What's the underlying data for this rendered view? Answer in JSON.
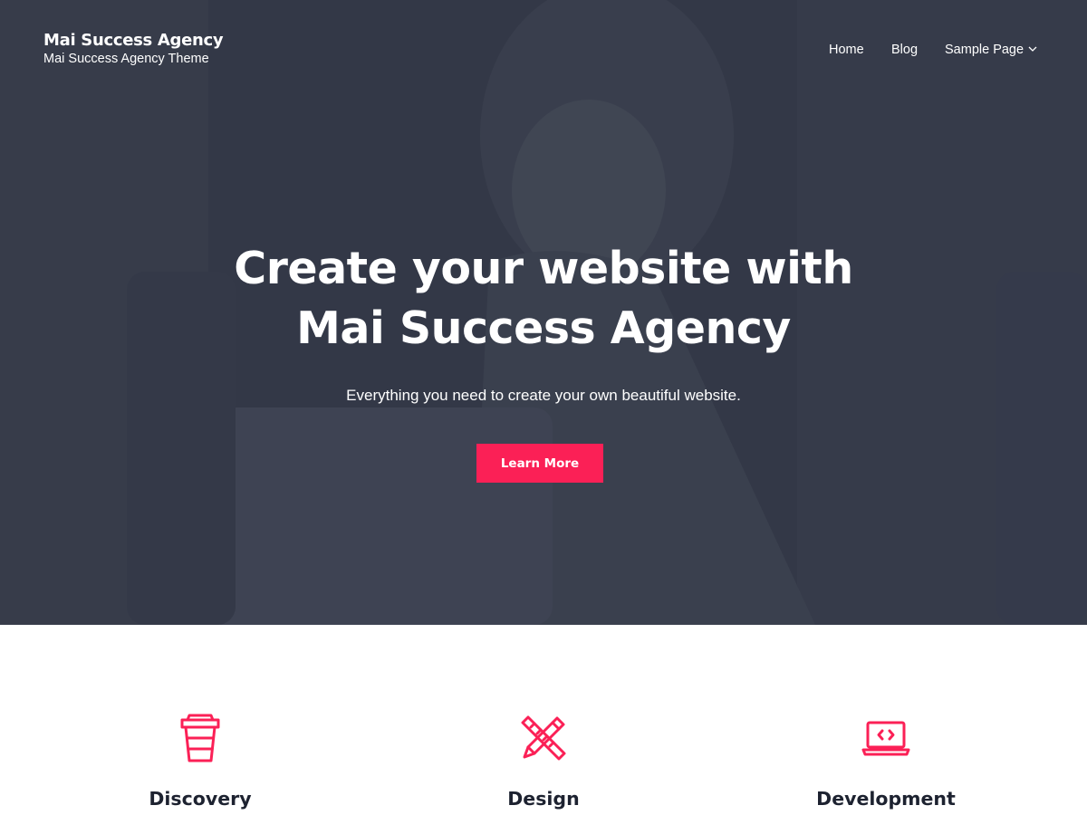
{
  "site": {
    "title": "Mai Success Agency",
    "tagline": "Mai Success Agency Theme"
  },
  "nav": {
    "items": [
      {
        "label": "Home"
      },
      {
        "label": "Blog"
      },
      {
        "label": "Sample Page",
        "icon": "chevron-down-icon"
      }
    ]
  },
  "hero": {
    "heading_line1": "Create your website with",
    "heading_line2": "Mai Success Agency",
    "subheading": "Everything you need to create your own beautiful website.",
    "cta_label": "Learn More"
  },
  "features": [
    {
      "title": "Discovery",
      "icon": "coffee-cup-icon"
    },
    {
      "title": "Design",
      "icon": "pencil-ruler-icon"
    },
    {
      "title": "Development",
      "icon": "laptop-code-icon"
    }
  ],
  "colors": {
    "accent": "#fb2056",
    "hero_overlay": "#3a3f4d",
    "heading_dark": "#1d2230",
    "white": "#ffffff"
  }
}
